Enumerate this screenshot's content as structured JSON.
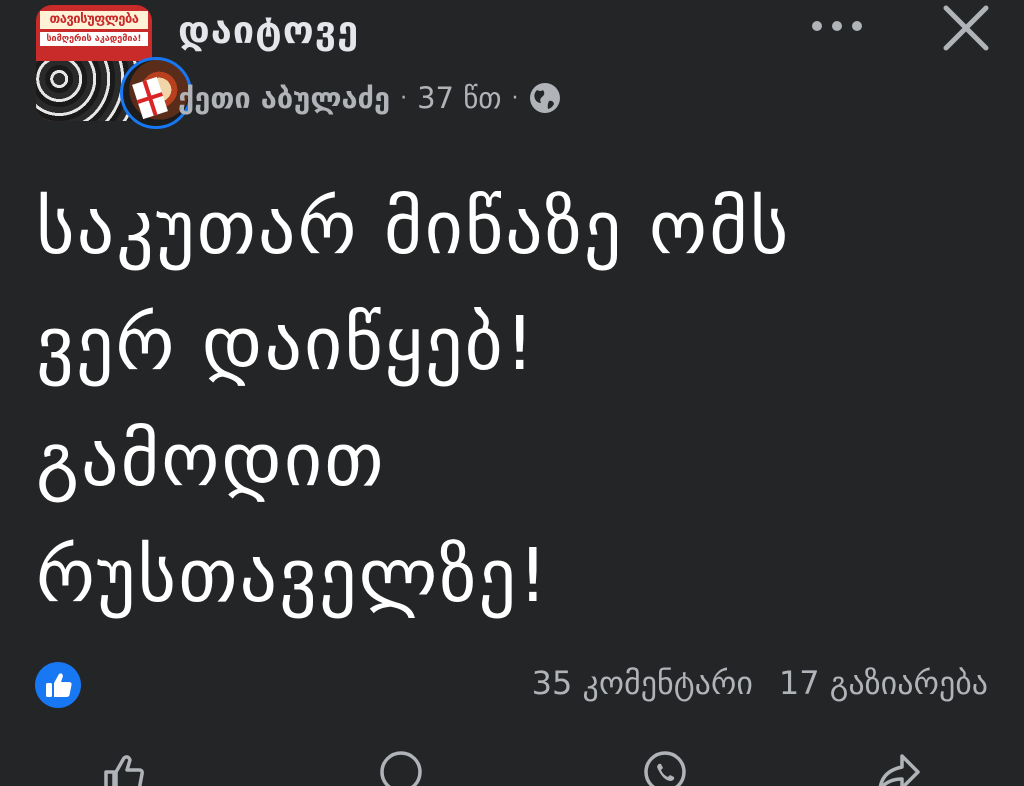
{
  "header": {
    "group_name": "დაიტოვე",
    "group_avatar_title": "თავისუფლება",
    "group_avatar_subtitle": "სიმღერის აკადემია!",
    "author": "ქეთი აბულაძე",
    "time": "37 წთ",
    "separator": "·",
    "privacy_icon": "globe-icon",
    "more_icon": "more-horizontal-icon",
    "close_icon": "close-icon"
  },
  "post": {
    "lines": [
      "საკუთარ მიწაზე ომს",
      "ვერ დაიწყებ!",
      "გამოდით",
      "რუსთაველზე!"
    ]
  },
  "reactions": {
    "icon": "like-icon",
    "comments": "35 კომენტარი",
    "shares": "17 გაზიარება"
  },
  "actions": {
    "icons": [
      "like-icon",
      "comment-icon",
      "whatsapp-icon",
      "share-icon"
    ]
  },
  "colors": {
    "background": "#242526",
    "accent": "#1877f2",
    "secondary_text": "#b0b3b8"
  }
}
